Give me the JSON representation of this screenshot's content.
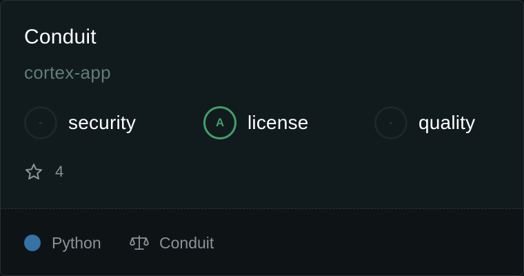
{
  "card": {
    "title": "Conduit",
    "owner": "cortex-app",
    "scores": [
      {
        "grade": "-",
        "label": "security",
        "state": "none"
      },
      {
        "grade": "A",
        "label": "license",
        "state": "graded"
      },
      {
        "grade": "-",
        "label": "quality",
        "state": "none"
      }
    ],
    "stars": "4",
    "language": {
      "name": "Python",
      "color": "#3572A5"
    },
    "license": "Conduit"
  },
  "colors": {
    "grade_a": "#3fa06a",
    "owner_text": "#5f7e77",
    "muted_text": "#8a9396"
  }
}
